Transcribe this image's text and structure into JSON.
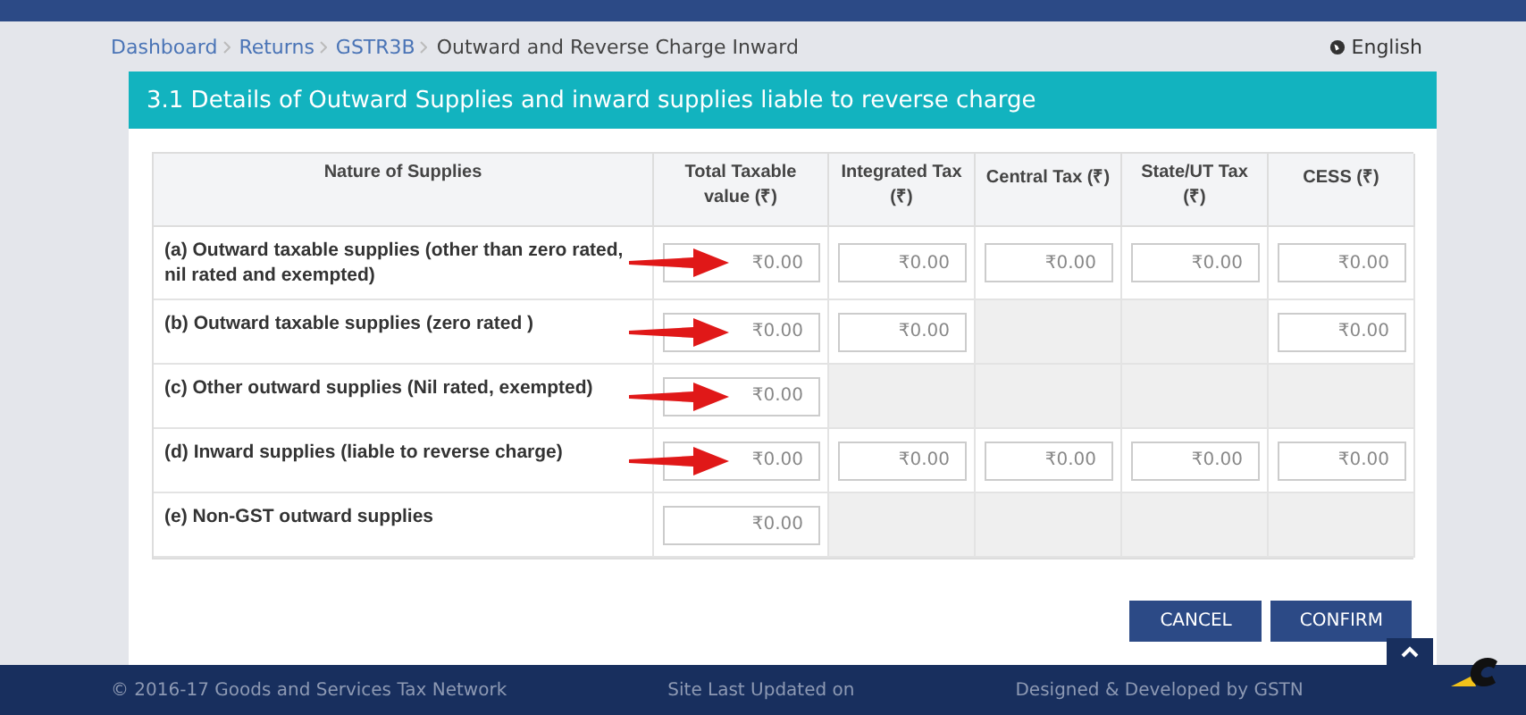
{
  "breadcrumb": [
    {
      "label": "Dashboard",
      "link": true
    },
    {
      "label": "Returns",
      "link": true
    },
    {
      "label": "GSTR3B",
      "link": true
    },
    {
      "label": "Outward and Reverse Charge Inward",
      "link": false
    }
  ],
  "language": "English",
  "panel_title": "3.1 Details of Outward Supplies and inward supplies liable to reverse charge",
  "table": {
    "columns": [
      "Nature of Supplies",
      "Total Taxable value (₹)",
      "Integrated Tax (₹)",
      "Central Tax (₹)",
      "State/UT Tax (₹)",
      "CESS (₹)"
    ],
    "rows": [
      {
        "arrow": true,
        "cells": [
          {
            "kind": "label",
            "text": "(a) Outward taxable supplies (other than zero rated, nil rated and exempted)"
          },
          {
            "kind": "field",
            "placeholder": "₹0.00"
          },
          {
            "kind": "field",
            "placeholder": "₹0.00"
          },
          {
            "kind": "field",
            "placeholder": "₹0.00"
          },
          {
            "kind": "field",
            "placeholder": "₹0.00"
          },
          {
            "kind": "field",
            "placeholder": "₹0.00"
          }
        ]
      },
      {
        "arrow": true,
        "cells": [
          {
            "kind": "label",
            "text": "(b) Outward taxable supplies (zero rated )"
          },
          {
            "kind": "field",
            "placeholder": "₹0.00"
          },
          {
            "kind": "field",
            "placeholder": "₹0.00"
          },
          {
            "kind": "blank"
          },
          {
            "kind": "blank"
          },
          {
            "kind": "field",
            "placeholder": "₹0.00"
          }
        ]
      },
      {
        "arrow": true,
        "cells": [
          {
            "kind": "label",
            "text": "(c) Other outward supplies (Nil rated, exempted)"
          },
          {
            "kind": "field",
            "placeholder": "₹0.00"
          },
          {
            "kind": "blank"
          },
          {
            "kind": "blank"
          },
          {
            "kind": "blank"
          },
          {
            "kind": "blank"
          }
        ]
      },
      {
        "arrow": true,
        "cells": [
          {
            "kind": "label",
            "text": "(d) Inward supplies (liable to reverse charge)"
          },
          {
            "kind": "field",
            "placeholder": "₹0.00"
          },
          {
            "kind": "field",
            "placeholder": "₹0.00"
          },
          {
            "kind": "field",
            "placeholder": "₹0.00"
          },
          {
            "kind": "field",
            "placeholder": "₹0.00"
          },
          {
            "kind": "field",
            "placeholder": "₹0.00"
          }
        ]
      },
      {
        "arrow": false,
        "cells": [
          {
            "kind": "label",
            "text": "(e) Non-GST outward supplies"
          },
          {
            "kind": "field",
            "placeholder": "₹0.00"
          },
          {
            "kind": "blank"
          },
          {
            "kind": "blank"
          },
          {
            "kind": "blank"
          },
          {
            "kind": "blank"
          }
        ]
      }
    ]
  },
  "buttons": [
    "CANCEL",
    "CONFIRM"
  ],
  "footer": [
    "© 2016-17 Goods and Services Tax Network",
    "Site Last Updated on",
    "Designed & Developed by GSTN"
  ]
}
